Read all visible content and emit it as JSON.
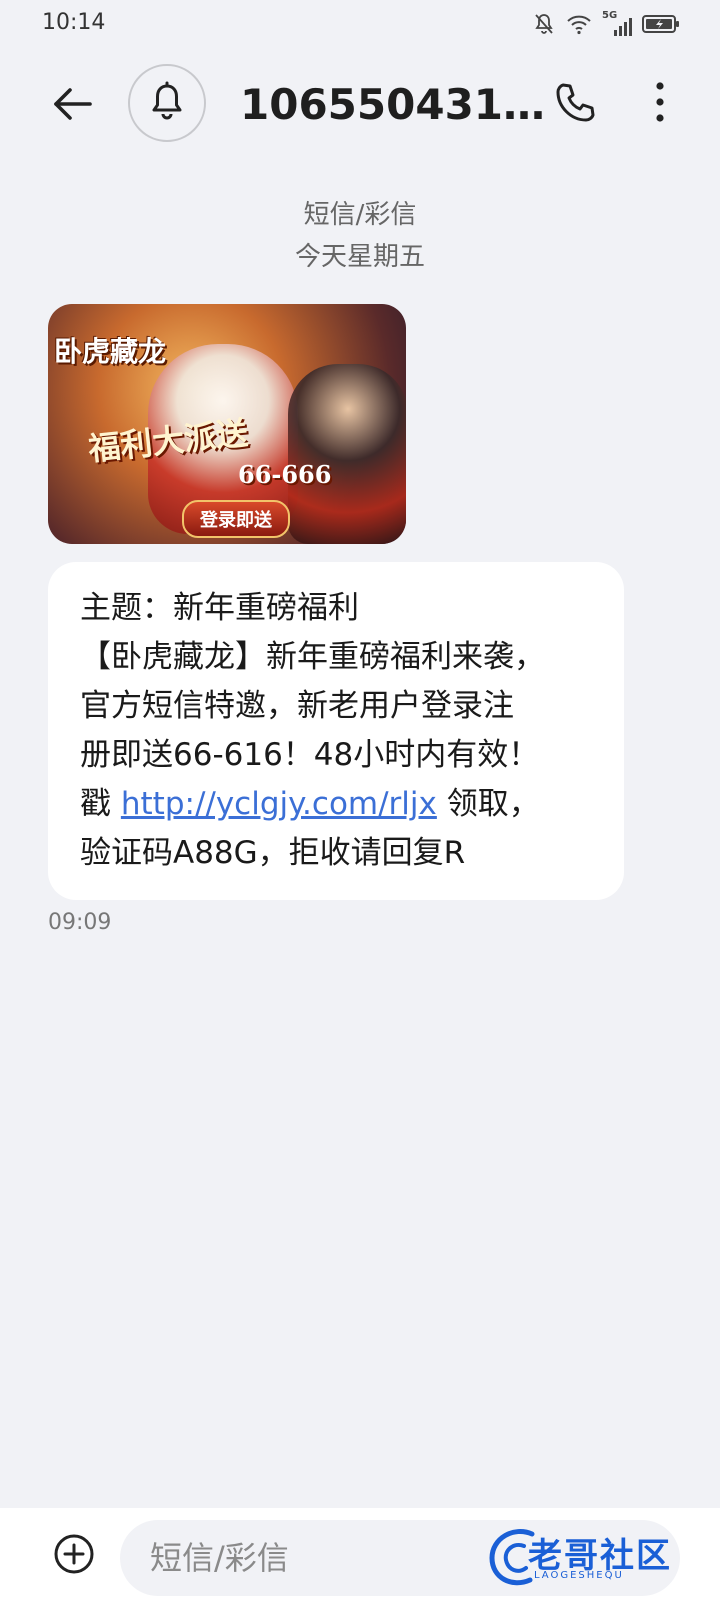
{
  "status_bar": {
    "time": "10:14",
    "network_label": "5G",
    "icons": [
      "mute-icon",
      "wifi-icon",
      "signal-icon",
      "battery-charging-icon"
    ]
  },
  "header": {
    "contact": "106550431…",
    "icons": [
      "back-arrow-icon",
      "bell-icon",
      "phone-icon",
      "more-vertical-icon"
    ]
  },
  "conversation": {
    "channel": "短信/彩信",
    "date": "今天星期五"
  },
  "banner": {
    "title": "卧虎藏龙",
    "slogan": "福利大派送",
    "amount": "66-666",
    "badge": "登录即送"
  },
  "message": {
    "line1": "主题：新年重磅福利",
    "line2": "【卧虎藏龙】新年重磅福利来袭，",
    "line3": "官方短信特邀，新老用户登录注",
    "line4": "册即送66-616！48小时内有效！",
    "line5_prefix": "戳 ",
    "link": "http://yclgjy.com/rljx",
    "line5_suffix": " 领取，",
    "line6": "验证码A88G，拒收请回复R",
    "time": "09:09"
  },
  "composer": {
    "placeholder": "短信/彩信",
    "icons": [
      "add-circle-icon"
    ]
  },
  "watermark": {
    "text": "老哥社区",
    "subtext": "LAOGESHEQU"
  },
  "colors": {
    "background": "#f1f2f6",
    "bubble": "#ffffff",
    "link": "#3b6fd6",
    "watermark": "#1a5fd6"
  }
}
